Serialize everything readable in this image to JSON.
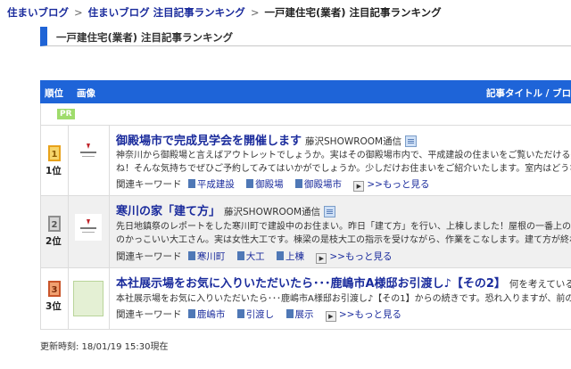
{
  "breadcrumb": {
    "items": [
      "住まいブログ",
      "住まいブログ 注目記事ランキング"
    ],
    "current": "一戸建住宅(業者) 注目記事ランキング",
    "separator": ">"
  },
  "page_title": "一戸建住宅(業者) 注目記事ランキング",
  "table": {
    "headers": {
      "rank": "順位",
      "image": "画像",
      "title": "記事タイトル / ブロ"
    },
    "pr_label": "PR",
    "kw_label": "関連キーワード",
    "more_label": ">>もっと見る"
  },
  "articles": [
    {
      "rank": "1位",
      "rank_num": "1",
      "rank_color": "#e8a21a",
      "title": "御殿場市で完成見学会を開催します",
      "author": "藤沢SHOWROOM通信",
      "snippet1": "神奈川から御殿場と言えばアウトレットでしょうか。実はその御殿場市内で、平成建設の住まいをご覧いただける完成",
      "snippet2": "ね！そんな気持ちでぜひご予約してみてはいかがでしょうか。少しだけお住まいをご紹介いたします。室内はどうなって",
      "keywords": [
        "平成建設",
        "御殿場",
        "御殿場市"
      ]
    },
    {
      "rank": "2位",
      "rank_num": "2",
      "rank_color": "#9a9a9a",
      "title": "寒川の家「建て方」",
      "author": "藤沢SHOWROOM通信",
      "snippet1": "先日地鎮祭のレポートをした寒川町で建設中のお住まい。昨日「建て方」を行い、上棟しました！屋根の一番上の「棟(",
      "snippet2": "のかっこいい大工さん。実は女性大工です。棟梁の是枝大工の指示を受けながら、作業をこなします。建て方が終わっ",
      "keywords": [
        "寒川町",
        "大工",
        "上棟"
      ]
    },
    {
      "rank": "3位",
      "rank_num": "3",
      "rank_color": "#d06a2a",
      "title": "本社展示場をお気に入りいただいたら･･･鹿嶋市A様邸お引渡し♪【その2】",
      "author": "何を考えているの",
      "snippet1": "本社展示場をお気に入りいただいたら･･･鹿嶋市A様邸お引渡し♪【その1】からの続きです。恐れ入りますが、前の記",
      "snippet2": "",
      "keywords": [
        "鹿嶋市",
        "引渡し",
        "展示"
      ]
    }
  ],
  "updated": "更新時刻: 18/01/19 15:30現在"
}
